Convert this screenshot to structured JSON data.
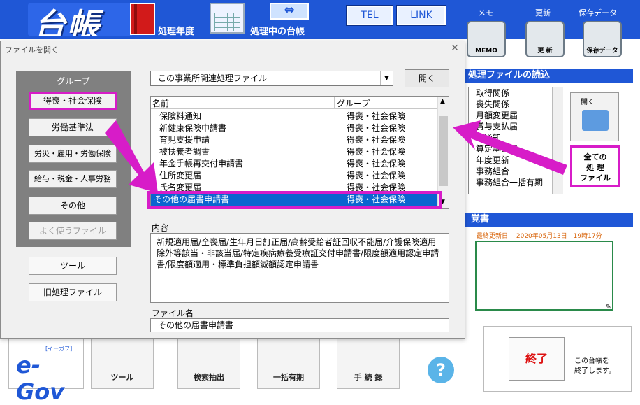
{
  "app": {
    "logo_text": "台帳",
    "year_label": "処理年度",
    "ledger_label": "処理中の台帳",
    "tel_label": "TEL",
    "link_label": "LINK"
  },
  "utilities": {
    "memo_caption": "メモ",
    "memo_label": "MEMO",
    "update_caption": "更新",
    "update_label": "更 新",
    "backup_caption": "保存データ",
    "backup_label": "保存データ"
  },
  "read_panel": {
    "header": "処理ファイルの読込",
    "items": [
      "取得関係",
      "喪失関係",
      "月額変更届",
      "賞与支払届",
      "…通知",
      "算定基礎届",
      "年度更新",
      "事務組合",
      "事務組合一括有期"
    ],
    "open_label": "開く",
    "all_files_label": "全ての\n処 理\nファイル"
  },
  "memo_panel": {
    "header": "覚書",
    "last_updated": "最終更新日　 2020年05月13日　19時17分"
  },
  "bottom": {
    "egov_label": "e-Gov",
    "egov_sub": "[イーガブ]",
    "tool_label": "ツール",
    "search_label": "検索抽出",
    "ikkatsu_label": "一括有期",
    "procedure_label": "手 続 録",
    "end_label": "終了",
    "end_desc": "この台帳を\n終了します。"
  },
  "dialog": {
    "title": "ファイルを開く",
    "group_title": "グループ",
    "groups": [
      "得喪・社会保険",
      "労働基準法",
      "労災・雇用・労働保険",
      "給与・税金・人事労務",
      "その他",
      "よく使うファイル"
    ],
    "tool_button": "ツール",
    "old_files_button": "旧処理ファイル",
    "combo_value": "この事業所関連処理ファイル",
    "open_button": "開く",
    "list_header_name": "名前",
    "list_header_group": "グループ",
    "rows": [
      {
        "name": "保険料通知",
        "group": "得喪・社会保険"
      },
      {
        "name": "新健康保険申請書",
        "group": "得喪・社会保険"
      },
      {
        "name": "育児支援申請",
        "group": "得喪・社会保険"
      },
      {
        "name": "被扶養者調書",
        "group": "得喪・社会保険"
      },
      {
        "name": "年金手帳再交付申請書",
        "group": "得喪・社会保険"
      },
      {
        "name": "住所変更届",
        "group": "得喪・社会保険"
      },
      {
        "name": "氏名変更届",
        "group": "得喪・社会保険"
      },
      {
        "name": "その他の届書申請書",
        "group": "得喪・社会保険"
      }
    ],
    "content_label": "内容",
    "content_text": "新規適用届/全喪届/生年月日訂正届/高齢受給者証回収不能届/介護保険適用除外等該当・非該当届/特定疾病療養受療証交付申請書/限度額適用認定申請書/限度額適用・標準負担額減額認定申請書",
    "filename_label": "ファイル名",
    "filename_value": "その他の届書申請書"
  },
  "colors": {
    "accent_blue": "#1f57d6",
    "highlight_magenta": "#d71cc8",
    "selection_blue": "#0a64d0"
  }
}
